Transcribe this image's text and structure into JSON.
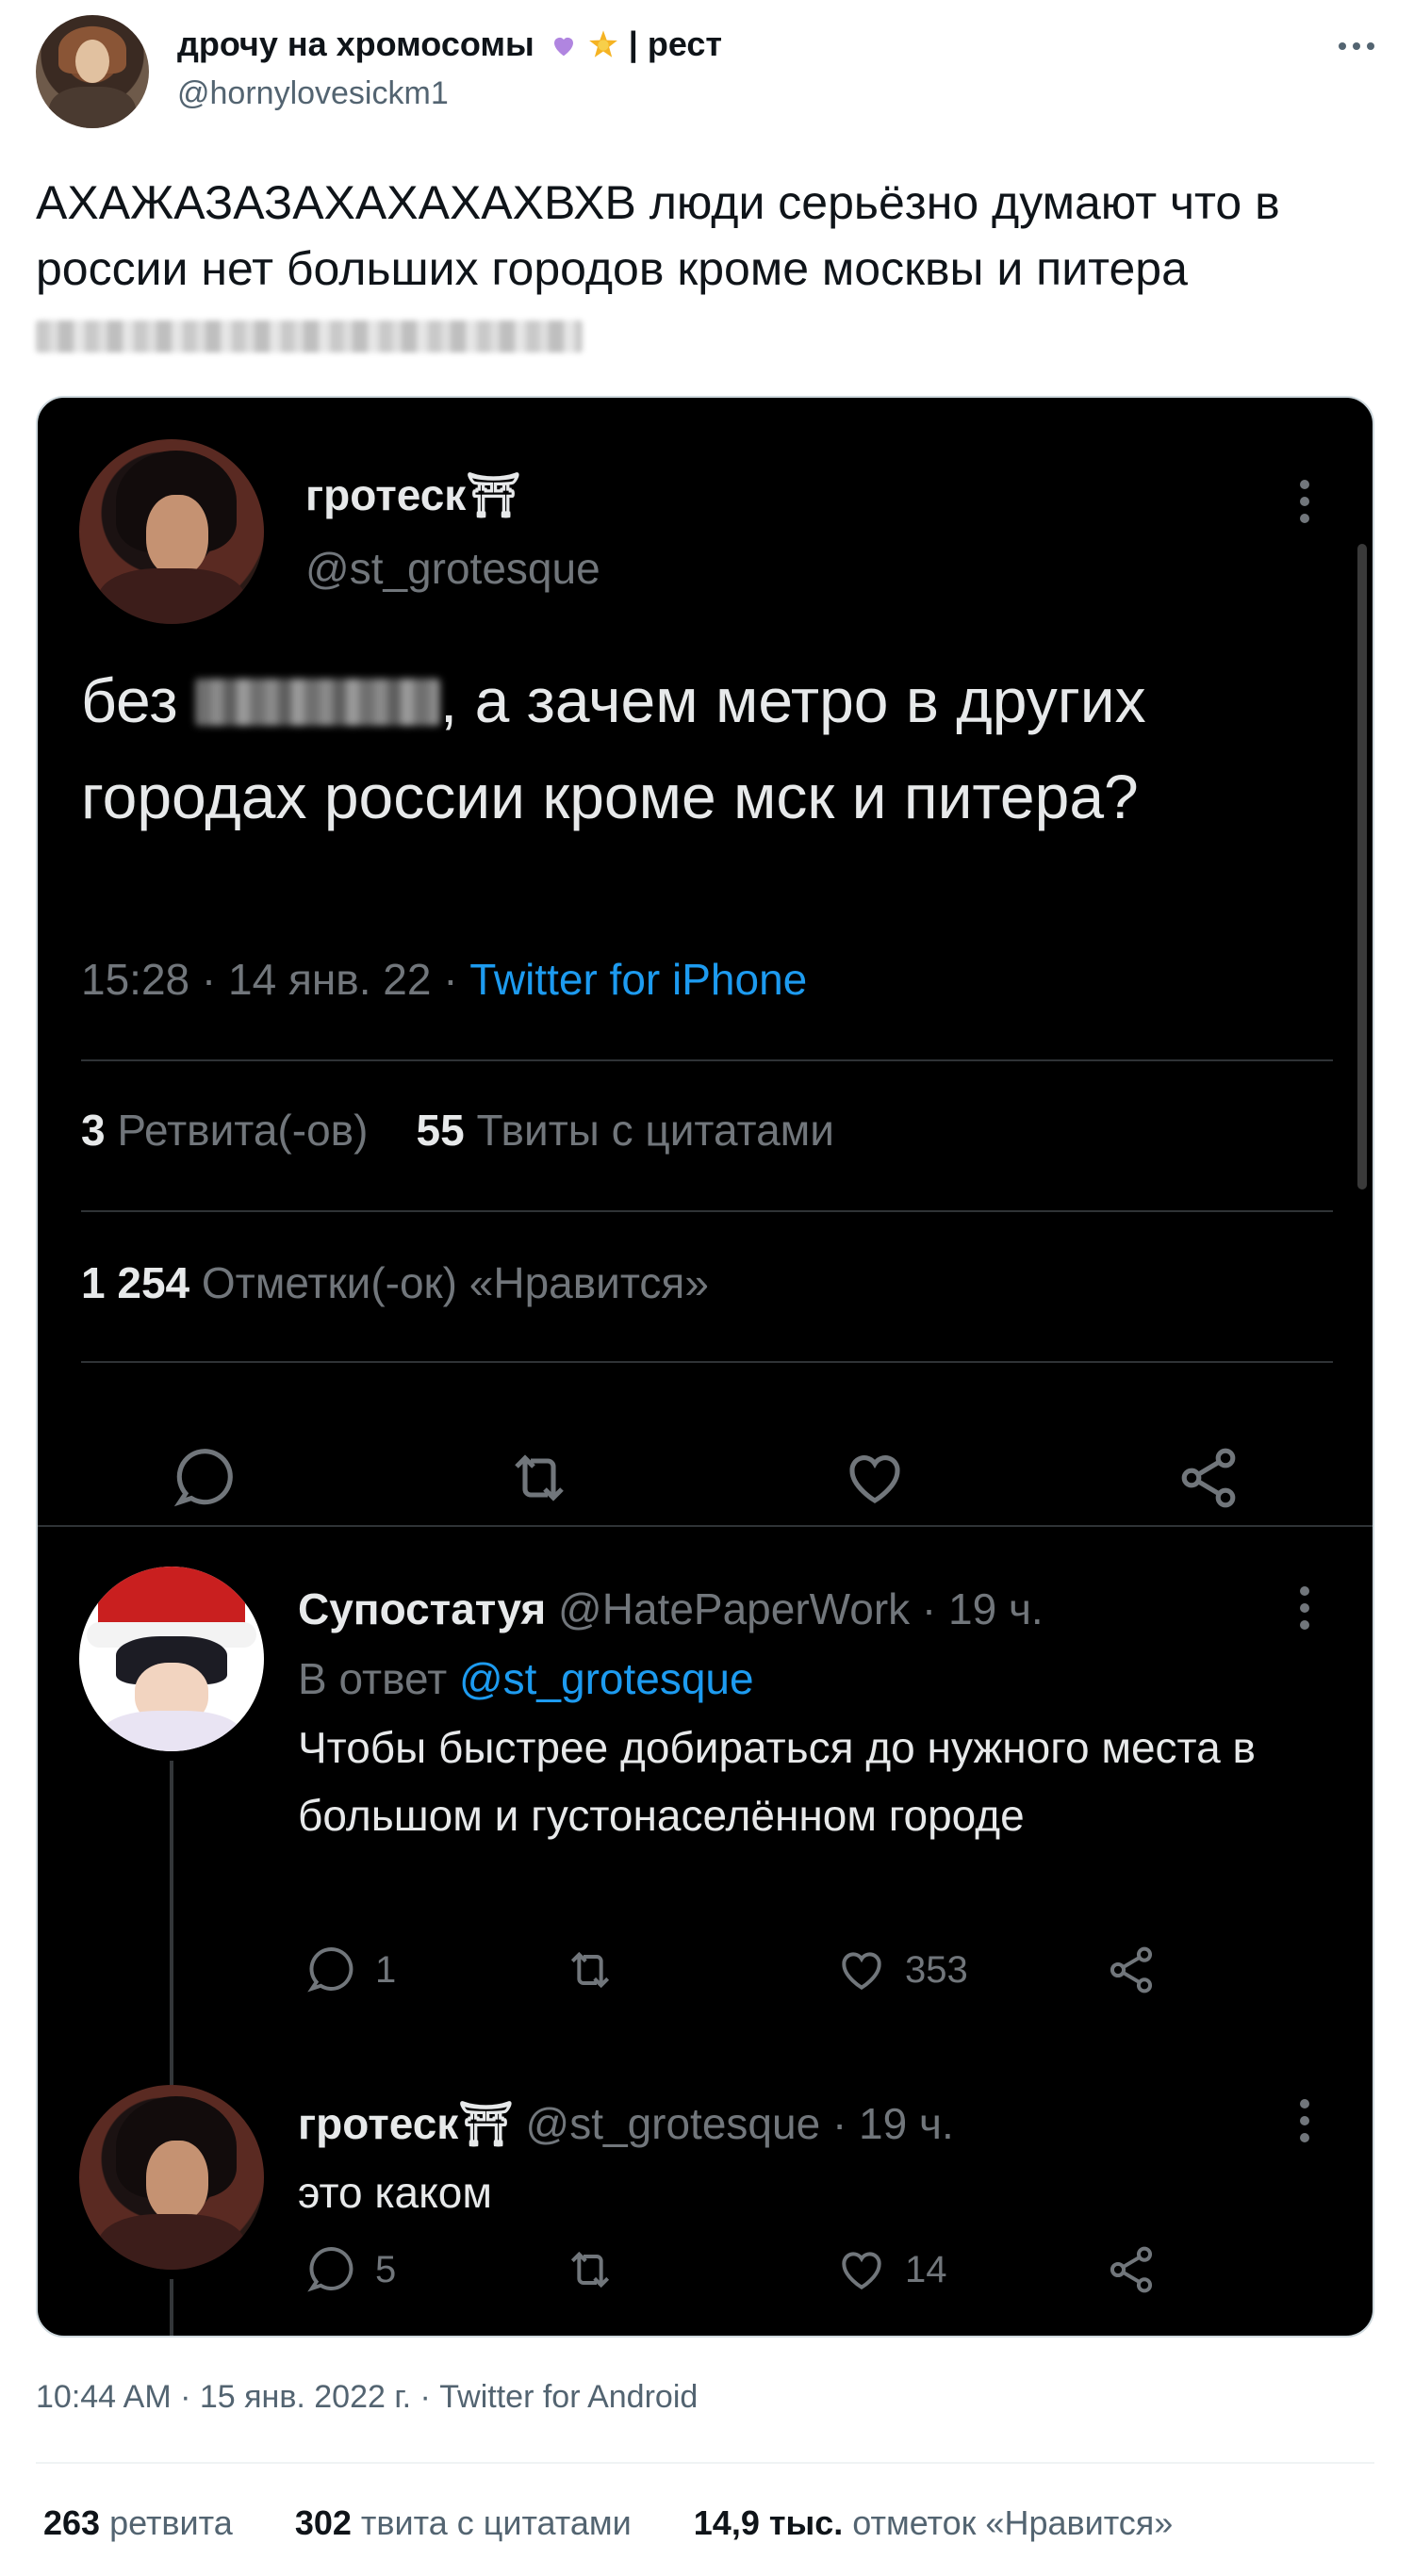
{
  "outer_tweet": {
    "author_name": "дрочу на хромосомы",
    "name_suffix": "| рест",
    "author_handle": "@hornylovesickm1",
    "text": "АХАЖАЗАЗАХАХАХАХВХВ люди серьёзно думают что в россии нет больших городов кроме москвы и питера",
    "timestamp": "10:44 AM · 15 янв. 2022 г. · Twitter for Android",
    "retweets_count": "263",
    "retweets_label": "ретвита",
    "quotes_count": "302",
    "quotes_label": "твита с цитатами",
    "likes_count": "14,9 тыс.",
    "likes_label": "отметок «Нравится»"
  },
  "embedded": {
    "main_tweet": {
      "author_name": "гротеск⛩",
      "author_handle": "@st_grotesque",
      "text_before_blur": "без",
      "text_after_blur": ", а зачем метро в других городах россии кроме мск и питера?",
      "time_date": "15:28 · 14 янв. 22 ·",
      "source": "Twitter for iPhone",
      "retweets_count": "3",
      "retweets_label": "Ретвита(-ов)",
      "quotes_count": "55",
      "quotes_label": "Твиты с цитатами",
      "likes_count": "1 254",
      "likes_label": "Отметки(-ок) «Нравится»"
    },
    "replies": [
      {
        "author_name": "Супостатуя",
        "author_handle": "@HatePaperWork · 19 ч.",
        "reply_to_prefix": "В ответ",
        "reply_to_handle": "@st_grotesque",
        "text": "Чтобы быстрее добираться до нужного места в большом и густонаселённом городе",
        "reply_count": "1",
        "like_count": "353"
      },
      {
        "author_name": "гротеск⛩",
        "author_handle": "@st_grotesque · 19 ч.",
        "text": "это каком",
        "reply_count": "5",
        "like_count": "14"
      }
    ]
  },
  "icons": [
    "more-icon",
    "reply-icon",
    "retweet-icon",
    "like-icon",
    "share-icon",
    "purple-heart-icon",
    "star-icon"
  ],
  "colors": {
    "accent_link": "#1d9bf0",
    "dark_bg": "#000000",
    "muted_dark": "#71767b",
    "muted_light": "#536471"
  }
}
